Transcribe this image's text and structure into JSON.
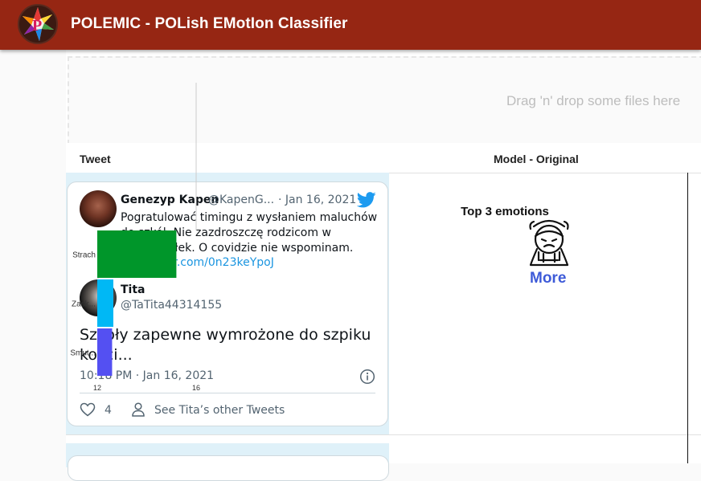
{
  "app": {
    "title": "POLEMIC - POLish EMotIon Classifier",
    "logo_icon": "polemic-logo-icon",
    "brand_color": "#962613"
  },
  "dropzone": {
    "text": "Drag 'n' drop some files here"
  },
  "table": {
    "headers": [
      "Tweet",
      "Model - Original"
    ]
  },
  "tweet": {
    "parent": {
      "name": "Genezyp Kapen",
      "handle": "@KapenG...",
      "date": "· Jan 16, 2021",
      "text": "Pogratulować timingu z wysłaniem maluchów do szkół. Nie zazdroszczę rodzicom w poniedziałek. O covidzie nie wspominam.",
      "link": "pic.twitter.com/0n23keYpoJ"
    },
    "reply": {
      "name": "Tita",
      "handle": "@TaTita44314155",
      "text": "Szkoły zapewne wymrożone do szpiku kości...",
      "datetime": "10:18 PM · Jan 16, 2021",
      "likes": "4",
      "other_tweets": "See Tita’s other Tweets"
    },
    "link_color": "#1b95e0",
    "bird_color": "#1d9bf0"
  },
  "chart_data": {
    "type": "bar",
    "orientation": "horizontal",
    "title": "Top 3 emotions",
    "categories": [
      "Strach",
      "Zask...",
      "Smut..."
    ],
    "values": [
      15.2,
      12.65,
      12.6
    ],
    "colors": [
      "#00962a",
      "#00b8f5",
      "#5450f2"
    ],
    "xlim": [
      12,
      16
    ],
    "xticks": [
      12,
      16
    ],
    "xlabel": "",
    "ylabel": ""
  },
  "prediction": {
    "emotion_icon": "scared-face-icon",
    "more_label": "More"
  }
}
